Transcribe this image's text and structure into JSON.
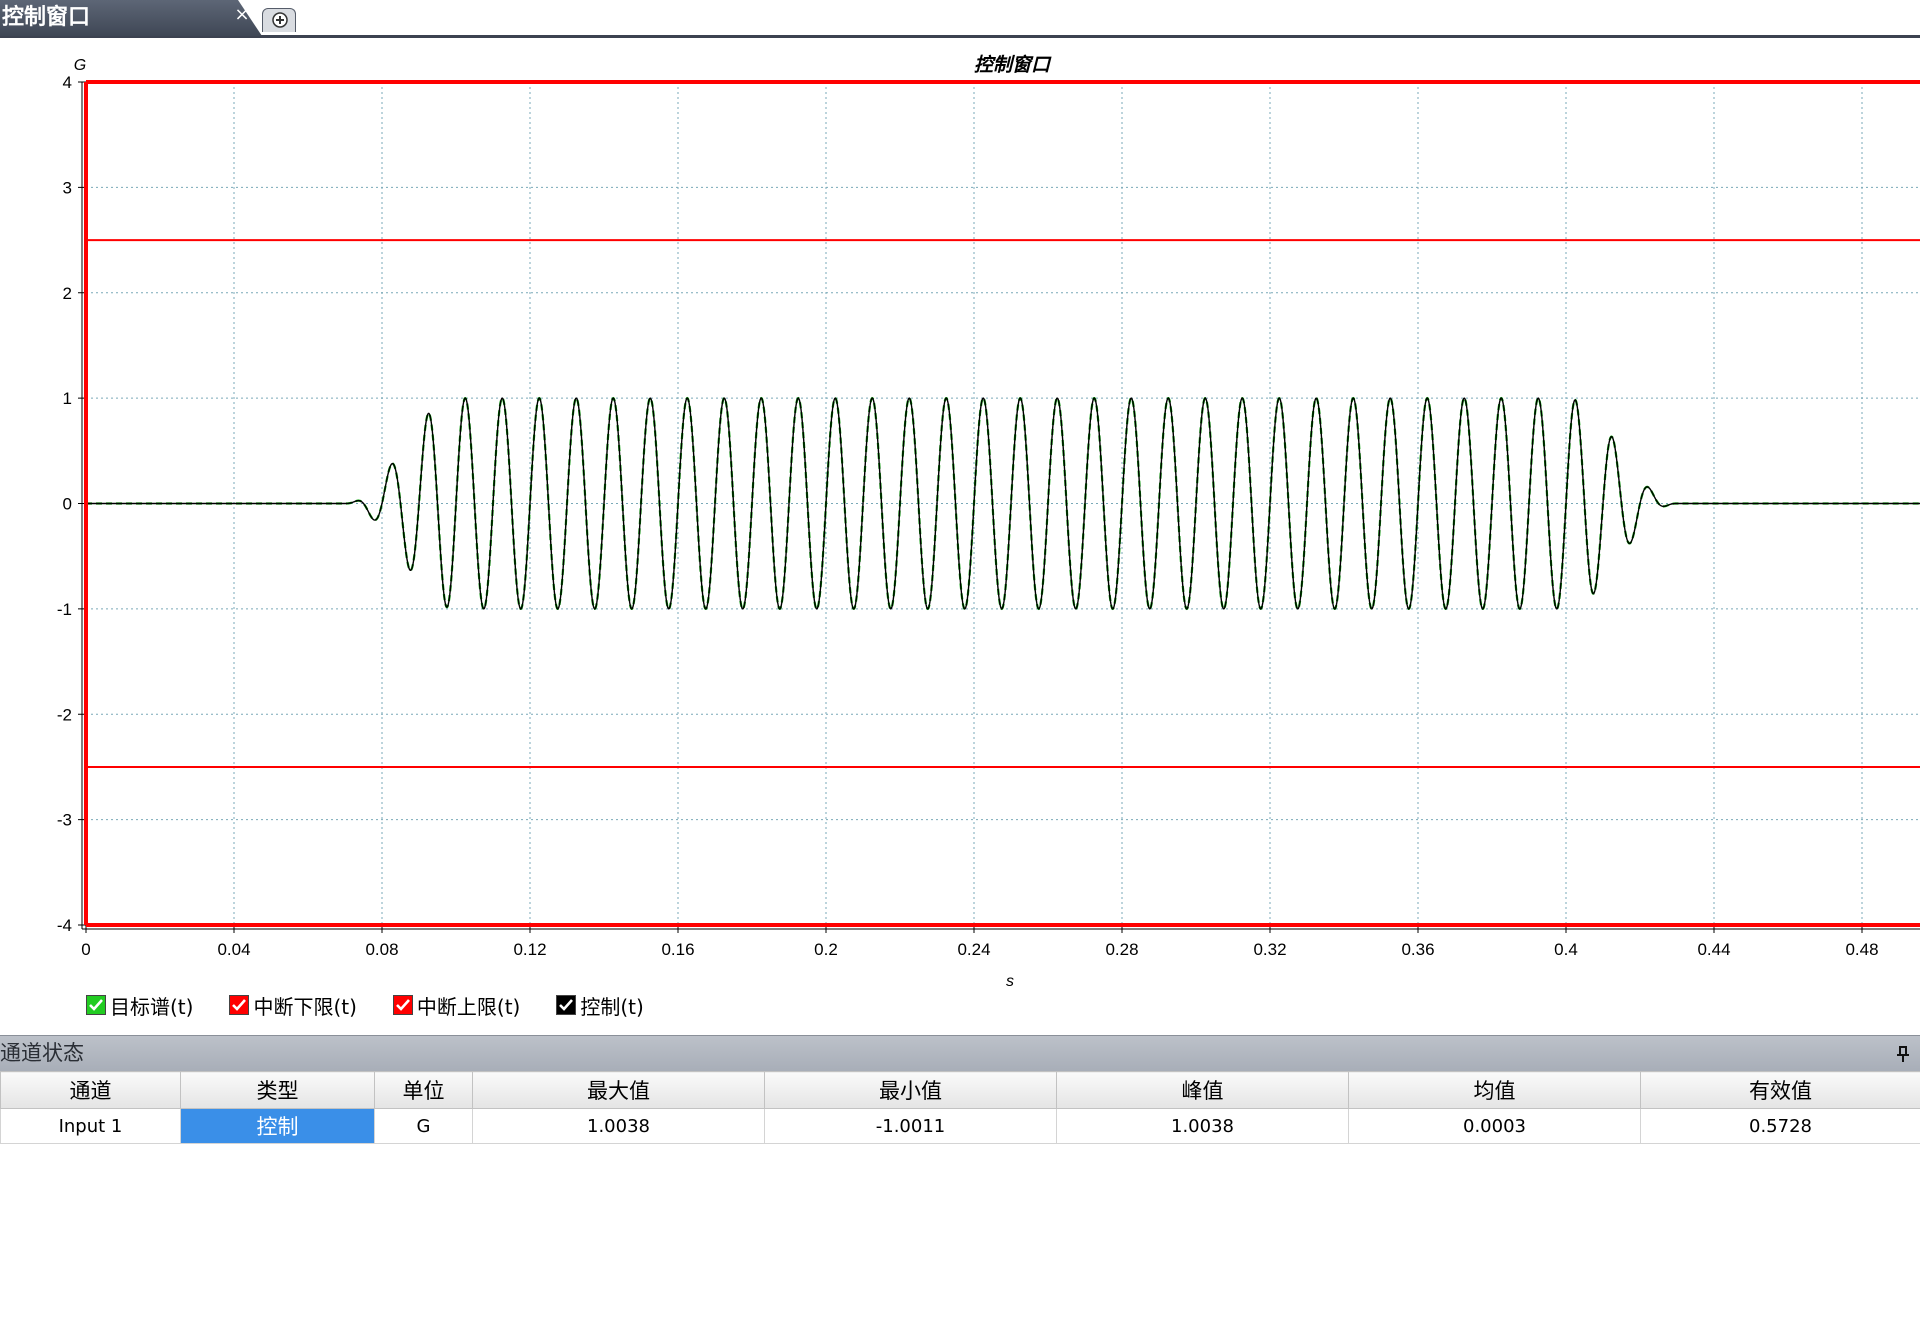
{
  "tabs": {
    "active_label": "控制窗口",
    "close_label": "×"
  },
  "chart_data": {
    "type": "line",
    "title": "控制窗口",
    "xlabel": "s",
    "ylabel": "G",
    "xlim": [
      0,
      0.5
    ],
    "ylim": [
      -4,
      4
    ],
    "xticks": [
      0,
      0.04,
      0.08,
      0.12,
      0.16,
      0.2,
      0.24,
      0.28,
      0.32,
      0.36,
      0.4,
      0.44,
      0.48
    ],
    "yticks": [
      4,
      3,
      2,
      1,
      0,
      -1,
      -2,
      -3,
      -4
    ],
    "grid": true,
    "legend_position": "bottom-left",
    "series": [
      {
        "name": "目标谱(t)",
        "color": "#00a000",
        "style": "dashed",
        "signal": {
          "frequency_hz": 100,
          "amplitude": 1.0,
          "start_s": 0.07,
          "ramp_up_end_s": 0.1,
          "ramp_down_start_s": 0.4,
          "end_s": 0.43
        }
      },
      {
        "name": "中断下限(t)",
        "color": "#ff0000",
        "value": -2.5
      },
      {
        "name": "中断上限(t)",
        "color": "#ff0000",
        "value": 2.5
      },
      {
        "name": "控制(t)",
        "color": "#000000",
        "signal": {
          "frequency_hz": 100,
          "amplitude": 1.0,
          "start_s": 0.07,
          "ramp_up_end_s": 0.1,
          "ramp_down_start_s": 0.4,
          "end_s": 0.43
        }
      }
    ],
    "legend_colors": [
      "#22cc22",
      "#ff0000",
      "#ff0000",
      "#000000"
    ]
  },
  "panel": {
    "title": "通道状态",
    "pin_icon": "pin-icon",
    "columns": [
      "通道",
      "类型",
      "单位",
      "最大值",
      "最小值",
      "峰值",
      "均值",
      "有效值"
    ],
    "rows": [
      [
        "Input 1",
        "控制",
        "G",
        "1.0038",
        "-1.0011",
        "1.0038",
        "0.0003",
        "0.5728"
      ]
    ]
  }
}
